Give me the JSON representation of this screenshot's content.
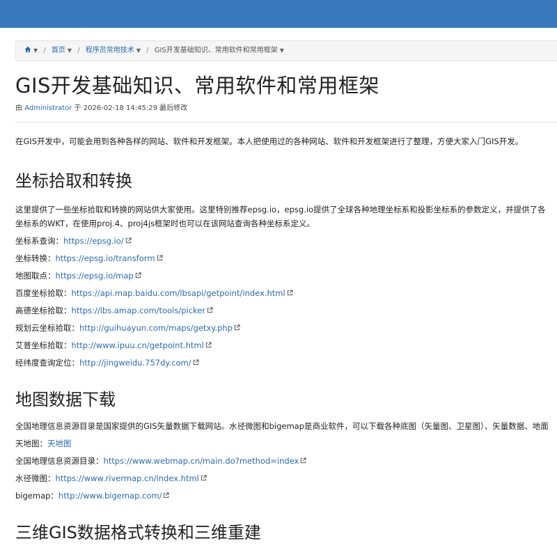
{
  "colors": {
    "topbar": "#3a78bd",
    "link": "#2a6ab0"
  },
  "breadcrumb": {
    "home_icon": "home-icon",
    "home": "首页",
    "category": "程序员常用技术",
    "current": "GIS开发基础知识、常用软件和常用框架"
  },
  "article": {
    "title": "GIS开发基础知识、常用软件和常用框架",
    "byline_prefix": "由",
    "author": "Administrator",
    "byline_suffix": "于 2026-02-18 14:45:29 最后修改",
    "intro": "在GIS开发中，可能会用到各种各样的网站、软件和开发框架。本人把使用过的各种网站、软件和开发框架进行了整理，方便大家入门GIS开发。",
    "sections": [
      {
        "heading": "坐标拾取和转换",
        "paragraph_line1": "这里提供了一些坐标拾取和转换的网站供大家使用。这里特别推荐epsg.io，epsg.io提供了全球各种地理坐标系和投影坐标系的参数定义，并提供了各",
        "paragraph_line2": "坐标系的WKT，在使用proj.4、proj4js框架时也可以在该网站查询各种坐标系定义。",
        "links": [
          {
            "label": "坐标系查询：",
            "url": "https://epsg.io/"
          },
          {
            "label": "坐标转换：",
            "url": "https://epsg.io/transform"
          },
          {
            "label": "地图取点：",
            "url": "https://epsg.io/map"
          },
          {
            "label": "百度坐标拾取：",
            "url": "https://api.map.baidu.com/lbsapi/getpoint/index.html"
          },
          {
            "label": "高德坐标拾取：",
            "url": "https://lbs.amap.com/tools/picker"
          },
          {
            "label": "规划云坐标拾取：",
            "url": "http://guihuayun.com/maps/getxy.php"
          },
          {
            "label": "艾普坐标拾取：",
            "url": "http://www.ipuu.cn/getpoint.html"
          },
          {
            "label": "经纬度查询定位：",
            "url": "http://jingweidu.757dy.com/"
          }
        ]
      },
      {
        "heading": "地图数据下载",
        "paragraph_line1": "全国地理信息资源目录是国家提供的GIS矢量数据下载网站。水径微图和bigemap是商业软件，可以下载各种底图（矢量图、卫星图）、矢量数据、地面",
        "links": [
          {
            "label": "天地图：",
            "url": "天地图"
          },
          {
            "label": "全国地理信息资源目录：",
            "url": "https://www.webmap.cn/main.do?method=index"
          },
          {
            "label": "水径微图：",
            "url": "https://www.rivermap.cn/index.html"
          },
          {
            "label": "bigemap：",
            "url": "http://www.bigemap.com/"
          }
        ]
      },
      {
        "heading": "三维GIS数据格式转换和三维重建"
      }
    ]
  }
}
